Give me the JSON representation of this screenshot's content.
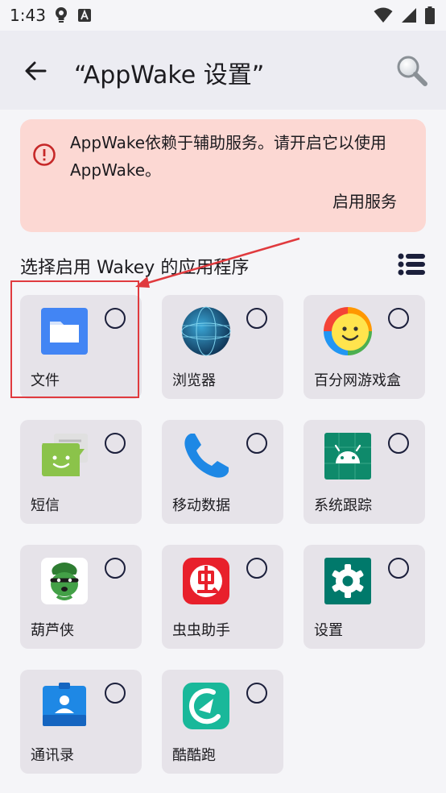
{
  "status": {
    "time": "1:43"
  },
  "app_bar": {
    "title": "“AppWake 设置”"
  },
  "banner": {
    "message": "AppWake依赖于辅助服务。请开启它以使用 AppWake。",
    "action_label": "启用服务",
    "accent_color": "#c62828"
  },
  "section": {
    "title": "选择启用 Wakey 的应用程序"
  },
  "apps": [
    {
      "label": "文件",
      "icon": "files-icon",
      "selected": false
    },
    {
      "label": "浏览器",
      "icon": "browser-icon",
      "selected": false
    },
    {
      "label": "百分网游戏盒",
      "icon": "game-box-icon",
      "selected": false
    },
    {
      "label": "短信",
      "icon": "messages-icon",
      "selected": false
    },
    {
      "label": "移动数据",
      "icon": "phone-icon",
      "selected": false
    },
    {
      "label": "系统跟踪",
      "icon": "android-icon",
      "selected": false
    },
    {
      "label": "葫芦侠",
      "icon": "huluxia-icon",
      "selected": false
    },
    {
      "label": "虫虫助手",
      "icon": "chongchong-icon",
      "selected": false
    },
    {
      "label": "设置",
      "icon": "settings-gear-icon",
      "selected": false
    },
    {
      "label": "通讯录",
      "icon": "contacts-icon",
      "selected": false
    },
    {
      "label": "酷酷跑",
      "icon": "kukupao-icon",
      "selected": false
    }
  ]
}
